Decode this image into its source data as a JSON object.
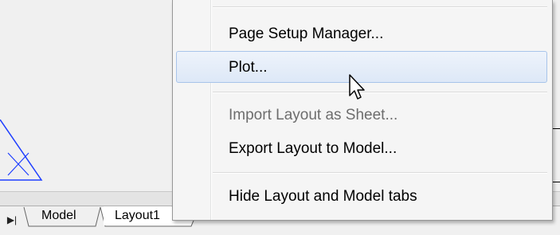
{
  "menu": {
    "items": [
      {
        "label": "Page Setup Manager...",
        "enabled": true,
        "highlighted": false
      },
      {
        "label": "Plot...",
        "enabled": true,
        "highlighted": true
      },
      {
        "label": "Import Layout as Sheet...",
        "enabled": false,
        "highlighted": false
      },
      {
        "label": "Export Layout to Model...",
        "enabled": true,
        "highlighted": false
      },
      {
        "label": "Hide Layout and Model tabs",
        "enabled": true,
        "highlighted": false
      }
    ]
  },
  "tabs": {
    "model": "Model",
    "layout": "Layout1"
  },
  "colors": {
    "highlight_border": "#a8c4ea",
    "disabled_text": "#6d6d6d",
    "drawing_line": "#1f3fff"
  }
}
